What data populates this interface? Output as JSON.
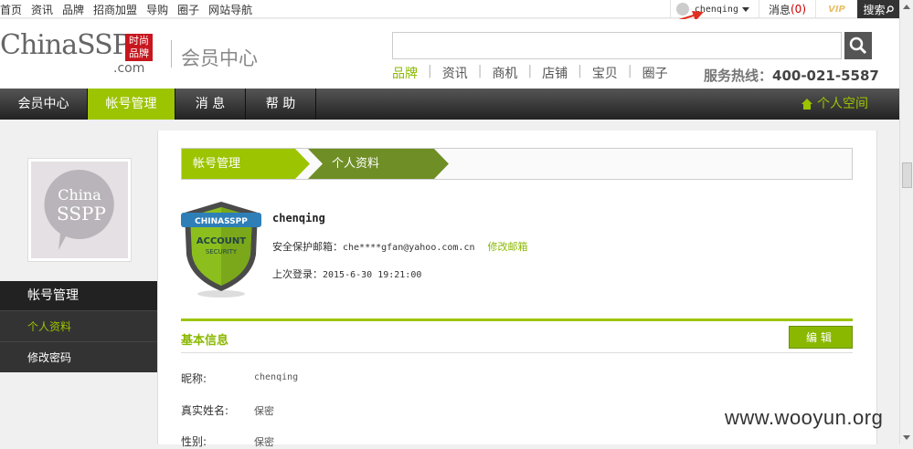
{
  "top_nav": {
    "links": [
      "首页",
      "资讯",
      "品牌",
      "招商加盟",
      "导购",
      "圈子",
      "网站导航"
    ],
    "username": "chenqing",
    "messages_label": "消息",
    "messages_count": "(0)",
    "vip_label": "VIP",
    "search_label": "搜索"
  },
  "header": {
    "logo_text": "ChinaSSPP",
    "logo_com": ".com",
    "logo_badge": "时尚品牌",
    "member_center": "会员中心",
    "categories": [
      "品牌",
      "资讯",
      "商机",
      "店铺",
      "宝贝",
      "圈子"
    ],
    "hotline_label": "服务热线：",
    "hotline_number": "400-021-5587"
  },
  "main_nav": {
    "items": [
      "会员中心",
      "帐号管理",
      "消 息",
      "帮 助"
    ],
    "active_index": 1,
    "personal_space": "个人空间"
  },
  "sidebar": {
    "avatar_text_1": "China",
    "avatar_text_2": "SSPP",
    "section_title": "帐号管理",
    "items": [
      "个人资料",
      "修改密码"
    ]
  },
  "breadcrumb": [
    "帐号管理",
    "个人资料"
  ],
  "account": {
    "badge_top": "CHINASSPP",
    "badge_line1": "ACCOUNT",
    "badge_line2": "SECURITY",
    "username": "chenqing",
    "email_label": "安全保护邮箱：",
    "email_value": "che****gfan@yahoo.com.cn",
    "email_action": "修改邮箱",
    "last_login_label": "上次登录：",
    "last_login_value": "2015-6-30 19:21:00"
  },
  "basic_info": {
    "title": "基本信息",
    "edit_button": "编辑",
    "fields": [
      {
        "label": "昵称:",
        "value": "chenqing"
      },
      {
        "label": "真实姓名:",
        "value": "保密"
      },
      {
        "label": "性别:",
        "value": "保密"
      }
    ]
  },
  "watermark": "www.wooyun.org",
  "colors": {
    "accent": "#9cc400",
    "accent_dark": "#6f8f26",
    "nav_bg": "#333333",
    "annotation": "#e03020"
  }
}
